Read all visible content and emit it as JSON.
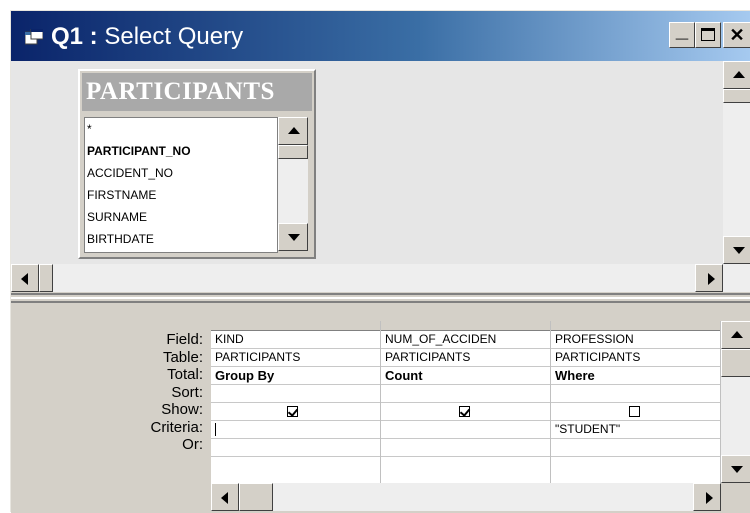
{
  "window": {
    "title_query_name": "Q1 :",
    "title_rest": "Select Query",
    "controls": {
      "minimize": "_",
      "maximize": "□",
      "close": "✕"
    },
    "title_icon": "query-icon"
  },
  "table": {
    "name": "PARTICIPANTS",
    "fields": [
      "*",
      "PARTICIPANT_NO",
      "ACCIDENT_NO",
      "FIRSTNAME",
      "SURNAME",
      "BIRTHDATE"
    ],
    "primary_key": "PARTICIPANT_NO"
  },
  "grid": {
    "row_labels": {
      "field": "Field:",
      "table": "Table:",
      "total": "Total:",
      "sort": "Sort:",
      "show": "Show:",
      "criteria": "Criteria:",
      "or": "Or:"
    },
    "columns": [
      {
        "field": "KIND",
        "table": "PARTICIPANTS",
        "total": "Group By",
        "sort": "",
        "show": true,
        "criteria": "",
        "or": ""
      },
      {
        "field": "NUM_OF_ACCIDEN",
        "table": "PARTICIPANTS",
        "total": "Count",
        "sort": "",
        "show": true,
        "criteria": "",
        "or": ""
      },
      {
        "field": "PROFESSION",
        "table": "PARTICIPANTS",
        "total": "Where",
        "sort": "",
        "show": false,
        "criteria": "\"STUDENT\"",
        "or": ""
      }
    ]
  },
  "colors": {
    "title_gradient_start": "#0a246a",
    "title_gradient_end": "#a6caf0",
    "chrome": "#d4d0c8",
    "table_header": "#a9a9a9"
  }
}
